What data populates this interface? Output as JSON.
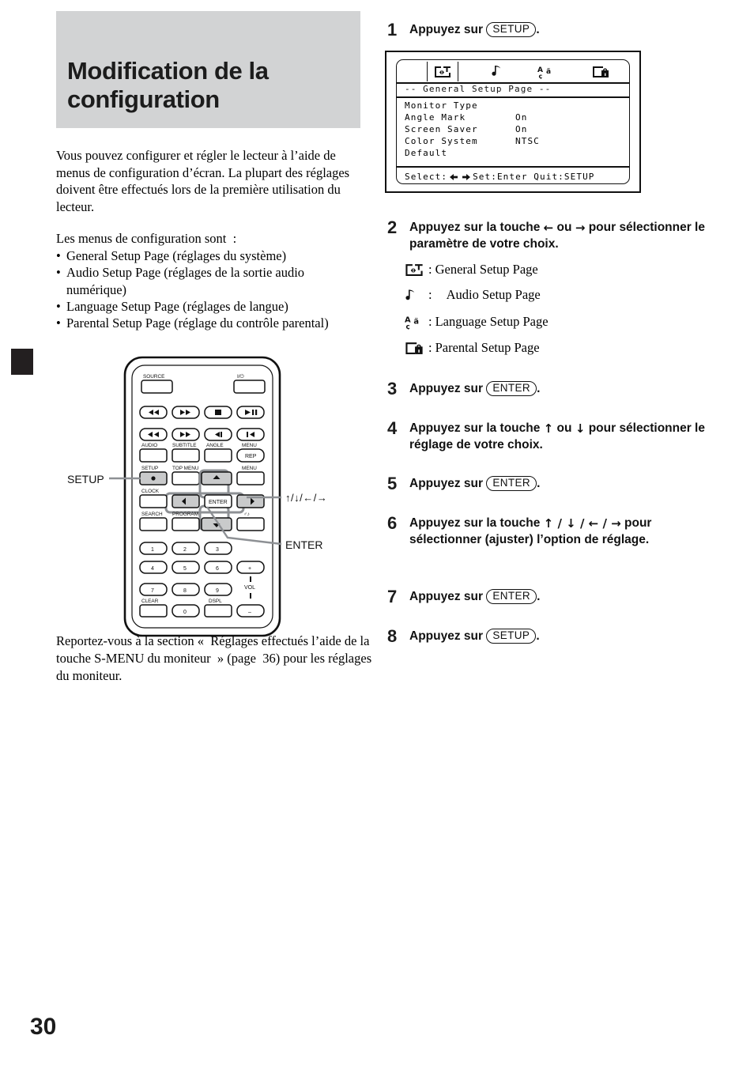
{
  "page": {
    "number": "30"
  },
  "left": {
    "title": "Modification de la configuration",
    "intro": "Vous pouvez configurer et régler le lecteur à l’aide de menus de configuration d’écran. La plupart des réglages doivent être effectués lors de la première utilisation du lecteur.",
    "menus_intro": "Les menus de configuration sont :",
    "menus": [
      "General Setup Page (réglages du système)",
      "Audio Setup Page (réglages de la sortie audio numérique)",
      "Language Setup Page (réglages de langue)",
      "Parental Setup Page (réglage du contrôle parental)"
    ],
    "bullet": "•",
    "remote": {
      "setup_callout": "SETUP",
      "arrows_callout": "↑/↓/←/→",
      "enter_callout": "ENTER",
      "labels": {
        "source": "SOURCE",
        "power": "I/⏻",
        "audio": "AUDIO",
        "subtitle": "SUBTITLE",
        "angle": "ANGLE",
        "rep": "REP",
        "setup": "SETUP",
        "top_menu": "TOP MENU",
        "menu": "MENU",
        "clock": "CLOCK",
        "enter": "ENTER",
        "search": "SEARCH",
        "program": "PROGRAM",
        "clear": "CLEAR",
        "dspl": "DSPL",
        "vol": "VOL",
        "vol_plus": "+",
        "vol_minus": "–",
        "keys": [
          "1",
          "2",
          "3",
          "4",
          "5",
          "6",
          "7",
          "8",
          "9",
          "0"
        ]
      }
    },
    "bottom_note": "Reportez-vous à la section « Réglages effectués l’aide de la touche S-MENU du moniteur » (page 36) pour les réglages du moniteur."
  },
  "right": {
    "steps": [
      {
        "num": "1",
        "pre": "Appuyez sur ",
        "key": "SETUP",
        "post": "."
      },
      {
        "num": "2",
        "text_a": "Appuyez sur la touche ",
        "arrow_a": "←",
        "text_b": " ou ",
        "arrow_b": "→",
        "text_c": " pour sélectionner le paramètre de votre choix."
      },
      {
        "num": "3",
        "pre": "Appuyez sur ",
        "key": "ENTER",
        "post": "."
      },
      {
        "num": "4",
        "text_a": "Appuyez sur la touche ",
        "arrow_a": "↑",
        "text_b": " ou ",
        "arrow_b": "↓",
        "text_c": " pour sélectionner le réglage de votre choix."
      },
      {
        "num": "5",
        "pre": "Appuyez sur ",
        "key": "ENTER",
        "post": "."
      },
      {
        "num": "6",
        "text_a": "Appuyez sur la touche ",
        "arrows": "↑ / ↓ / ← / →",
        "text_c": " pour sélectionner (ajuster) l’option de réglage."
      },
      {
        "num": "7",
        "pre": "Appuyez sur ",
        "key": "ENTER",
        "post": "."
      },
      {
        "num": "8",
        "pre": "Appuyez sur ",
        "key": "SETUP",
        "post": "."
      }
    ],
    "legend": [
      {
        "icon": "general-setup-icon",
        "colon": ":",
        "label": "General Setup Page"
      },
      {
        "icon": "audio-note-icon",
        "colon": ":",
        "label": "Audio Setup Page"
      },
      {
        "icon": "language-icon",
        "colon": ":",
        "label": "Language Setup Page"
      },
      {
        "icon": "parental-lock-icon",
        "colon": ":",
        "label": "Parental Setup Page"
      }
    ],
    "osd": {
      "title": "--  General Setup Page  --",
      "rows": [
        {
          "label": "Monitor Type",
          "value": ""
        },
        {
          "label": "Angle Mark",
          "value": "On"
        },
        {
          "label": "Screen Saver",
          "value": "On"
        },
        {
          "label": "Color System",
          "value": "NTSC"
        },
        {
          "label": "Default",
          "value": ""
        }
      ],
      "footer_select": "Select:",
      "footer_arrows": "←→",
      "footer_rest": " Set:Enter Quit:SETUP",
      "tabs": [
        "general-setup-icon",
        "audio-note-icon",
        "language-icon",
        "parental-lock-icon"
      ]
    }
  },
  "colors": {
    "band": "#d2d3d4",
    "ink": "#111111",
    "key_fill": "#c9cacb"
  }
}
